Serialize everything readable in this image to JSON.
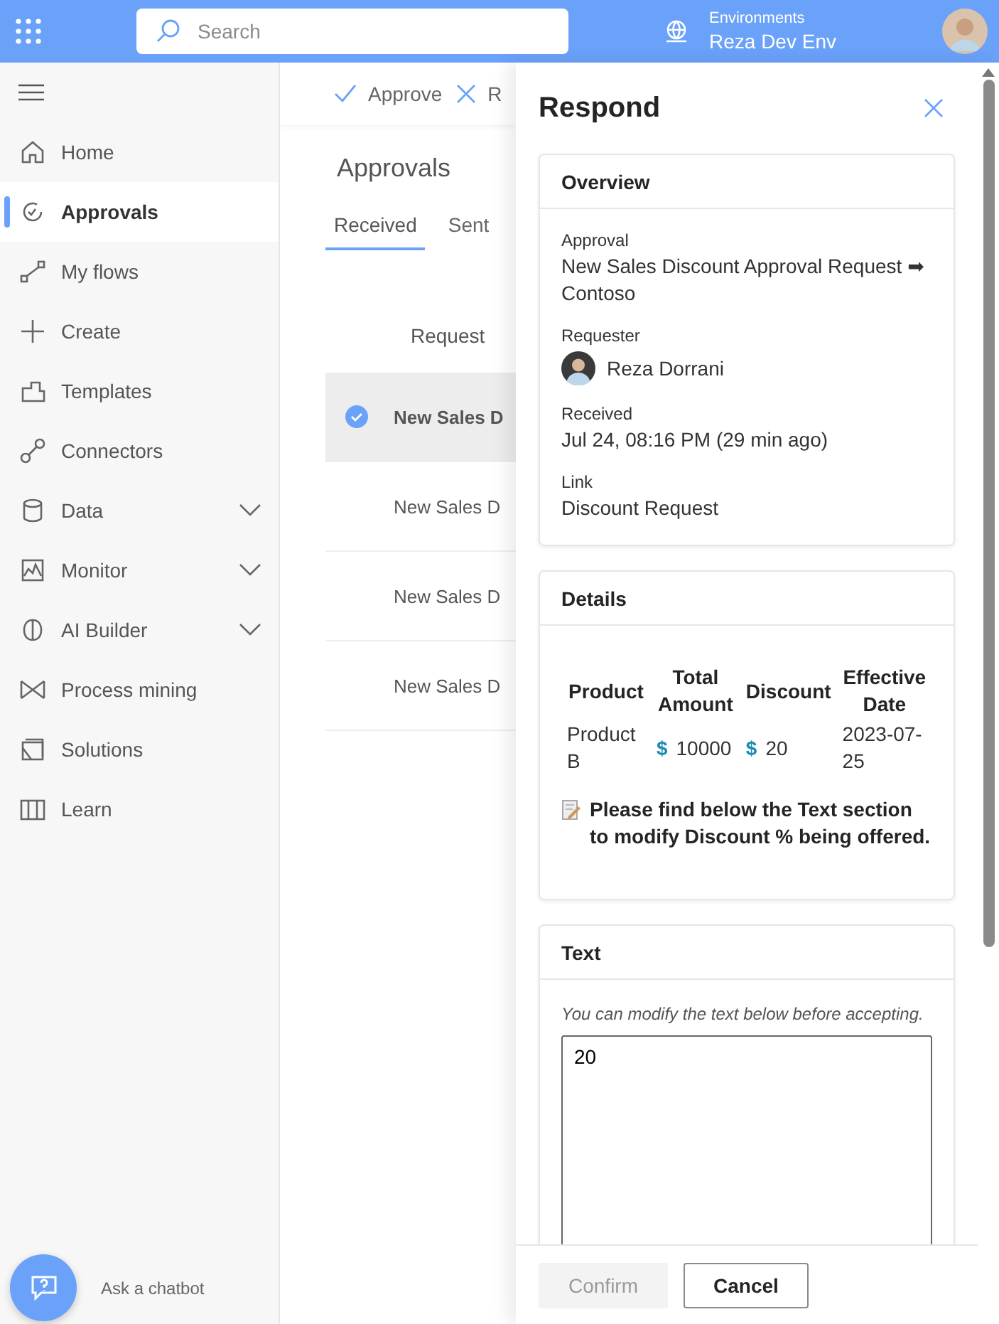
{
  "header": {
    "search": {
      "placeholder": "Search"
    },
    "environment_label": "Environments",
    "environment_name": "Reza Dev Env"
  },
  "sidebar": {
    "items": [
      {
        "label": "Home",
        "selected": false,
        "expandable": false
      },
      {
        "label": "Approvals",
        "selected": true,
        "expandable": false
      },
      {
        "label": "My flows",
        "selected": false,
        "expandable": false
      },
      {
        "label": "Create",
        "selected": false,
        "expandable": false
      },
      {
        "label": "Templates",
        "selected": false,
        "expandable": false
      },
      {
        "label": "Connectors",
        "selected": false,
        "expandable": false
      },
      {
        "label": "Data",
        "selected": false,
        "expandable": true
      },
      {
        "label": "Monitor",
        "selected": false,
        "expandable": true
      },
      {
        "label": "AI Builder",
        "selected": false,
        "expandable": true
      },
      {
        "label": "Process mining",
        "selected": false,
        "expandable": false
      },
      {
        "label": "Solutions",
        "selected": false,
        "expandable": false
      },
      {
        "label": "Learn",
        "selected": false,
        "expandable": false
      }
    ],
    "chatbot_label": "Ask a chatbot"
  },
  "main": {
    "toolbar": [
      "Approve",
      "R"
    ],
    "title": "Approvals",
    "tabs": [
      {
        "label": "Received",
        "selected": true
      },
      {
        "label": "Sent",
        "selected": false
      }
    ],
    "column": "Request",
    "rows": [
      {
        "request": "New Sales D",
        "selected": true
      },
      {
        "request": "New Sales D",
        "selected": false
      },
      {
        "request": "New Sales D",
        "selected": false
      },
      {
        "request": "New Sales D",
        "selected": false
      }
    ]
  },
  "panel": {
    "title": "Respond",
    "overview": {
      "heading": "Overview",
      "fields": [
        {
          "kind": "text",
          "label": "Approval",
          "value": "New Sales Discount Approval Request ➡ Contoso"
        },
        {
          "kind": "person",
          "label": "Requester",
          "value": "Reza Dorrani"
        },
        {
          "kind": "text",
          "label": "Received",
          "value": "Jul 24, 08:16 PM (29 min ago)"
        },
        {
          "kind": "text",
          "label": "Link",
          "value": "Discount Request"
        }
      ]
    },
    "details": {
      "heading": "Details",
      "columns": [
        "Product",
        "Total Amount",
        "Discount",
        "Effective Date"
      ],
      "row": [
        {
          "kind": "text",
          "text": "Product B"
        },
        {
          "kind": "money",
          "currency": "$",
          "text": "10000"
        },
        {
          "kind": "money",
          "currency": "$",
          "text": "20"
        },
        {
          "kind": "text",
          "text": "2023-07-25"
        }
      ],
      "note": "Please find below the Text section to modify Discount % being offered."
    },
    "text_section": {
      "heading": "Text",
      "hint": "You can modify the text below before accepting.",
      "value": "20"
    },
    "buttons": [
      {
        "label": "Confirm",
        "disabled": true
      },
      {
        "label": "Cancel",
        "disabled": false
      }
    ]
  }
}
